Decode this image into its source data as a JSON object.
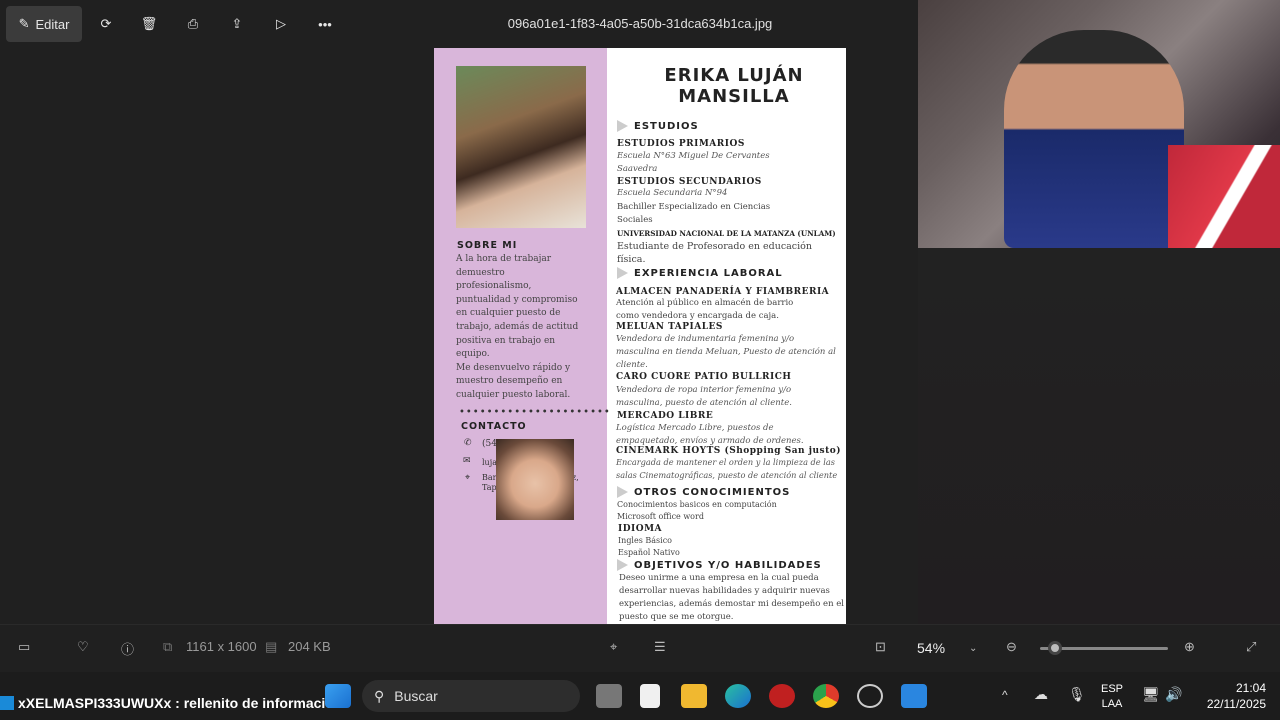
{
  "toolbar": {
    "edit_label": "Editar",
    "filename": "096a01e1-1f83-4a05-a50b-31dca634b1ca.jpg"
  },
  "resume": {
    "name_line1": "ERIKA LUJÁN",
    "name_line2": "MANSILLA",
    "about_title": "SOBRE MI",
    "about_text": [
      "A la hora de trabajar",
      "demuestro",
      "profesionalismo,",
      "puntualidad y compromiso",
      "en cualquier puesto de",
      "trabajo, además de actitud",
      "positiva en trabajo en",
      "equipo.",
      "Me desenvuelvo rápido y",
      "muestro desempeño en",
      "cualquier puesto laboral."
    ],
    "dots": "••••••••••••••••••••••",
    "contact_title": "CONTACTO",
    "contact_phone": "(54",
    "contact_email": "luja",
    "contact_addr1": "Bar",
    "contact_addr2": "Tap",
    "contact_addr_tail": "z,",
    "studies_title": "ESTUDIOS",
    "s1_title": "ESTUDIOS PRIMARIOS",
    "s1_l1": "Escuela N°63 Miguel De Cervantes",
    "s1_l2": "Saavedra",
    "s2_title": "ESTUDIOS SECUNDARIOS",
    "s2_l1": "Escuela Secundaria N°94",
    "s2_l2": "Bachiller Especializado en Ciencias",
    "s2_l3": "Sociales",
    "s3_title": "UNIVERSIDAD NACIONAL DE LA MATANZA (UNLAM)",
    "s3_l1": "Estudiante de Profesorado en educación",
    "s3_l2": "física.",
    "exp_title": "EXPERIENCIA LABORAL",
    "e1_title": "ALMACEN PANADERÍA Y FIAMBRERIA",
    "e1_l1": "Atención al público en almacén de barrio",
    "e1_l2": "como vendedora y encargada de caja.",
    "e2_title": "MELUAN TAPIALES",
    "e2_l1": "Vendedora de indumentaria femenina y/o",
    "e2_l2": "masculina en tienda Meluan, Puesto de atención al",
    "e2_l3": "cliente.",
    "e3_title": "CARO CUORE PATIO BULLRICH",
    "e3_l1": "Vendedora de ropa interior femenina y/o",
    "e3_l2": "masculina, puesto de atención al cliente.",
    "e4_title": "MERCADO LIBRE",
    "e4_l1": "Logística Mercado Libre, puestos de",
    "e4_l2": "empaquetado, envíos y armado de ordenes.",
    "e5_title": "CINEMARK HOYTS (Shopping San justo)",
    "e5_l1": "Encargada de mantener el orden y la limpieza de las",
    "e5_l2": "salas Cinematográficas, puesto de atención al cliente",
    "other_title": "OTROS CONOCIMIENTOS",
    "o_l1": "Conocimientos basicos en computación",
    "o_l2": "Microsoft office word",
    "lang_title": "IDIOMA",
    "lang_l1": "Ingles Básico",
    "lang_l2": "Español Nativo",
    "goals_title": "OBJETIVOS Y/O HABILIDADES",
    "g_l1": "Deseo unirme a una empresa en la cual pueda",
    "g_l2": "desarrollar nuevas habilidades y adquirir nuevas",
    "g_l3": "experiencias, además demostar mi desempeño en el",
    "g_l4": "puesto que se me otorgue."
  },
  "bottombar": {
    "dimensions": "1161 x 1600",
    "filesize": "204 KB",
    "zoom": "54%"
  },
  "taskbar": {
    "overlay_text": "xXELMASPI333UWUXx : rellenito de información",
    "search_label": "Buscar",
    "lang1": "ESP",
    "lang2": "LAA",
    "time": "21:04",
    "date": "22/11/2025"
  },
  "colors": {
    "sidebar": "#d9b6da",
    "background": "#202020",
    "taskbar": "#1c1c1c"
  }
}
